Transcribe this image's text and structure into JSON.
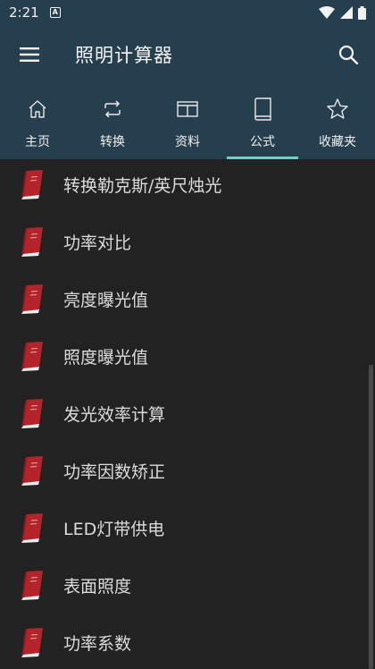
{
  "status": {
    "time": "2:21",
    "notif_glyph": "A",
    "icons": [
      "wifi-icon",
      "signal-icon",
      "battery-icon"
    ]
  },
  "appbar": {
    "title": "照明计算器",
    "icons": [
      "menu-icon",
      "search-icon"
    ]
  },
  "tabs": [
    {
      "label": "主页",
      "icon": "home-icon",
      "active": false
    },
    {
      "label": "转换",
      "icon": "convert-icon",
      "active": false
    },
    {
      "label": "资料",
      "icon": "data-icon",
      "active": false
    },
    {
      "label": "公式",
      "icon": "formula-book-icon",
      "active": true
    },
    {
      "label": "收藏夹",
      "icon": "star-icon",
      "active": false
    }
  ],
  "items": [
    {
      "label": "转换勒克斯/英尺烛光",
      "icon": "red-book-icon"
    },
    {
      "label": "功率对比",
      "icon": "red-book-icon"
    },
    {
      "label": "亮度曝光值",
      "icon": "red-book-icon"
    },
    {
      "label": "照度曝光值",
      "icon": "red-book-icon"
    },
    {
      "label": "发光效率计算",
      "icon": "red-book-icon"
    },
    {
      "label": "功率因数矫正",
      "icon": "red-book-icon"
    },
    {
      "label": "LED灯带供电",
      "icon": "red-book-icon"
    },
    {
      "label": "表面照度",
      "icon": "red-book-icon"
    },
    {
      "label": "功率系数",
      "icon": "red-book-icon"
    }
  ],
  "colors": {
    "bar": "#263f4f",
    "background": "#222222",
    "accent": "#6fcfc0",
    "book": "#b5232a"
  }
}
